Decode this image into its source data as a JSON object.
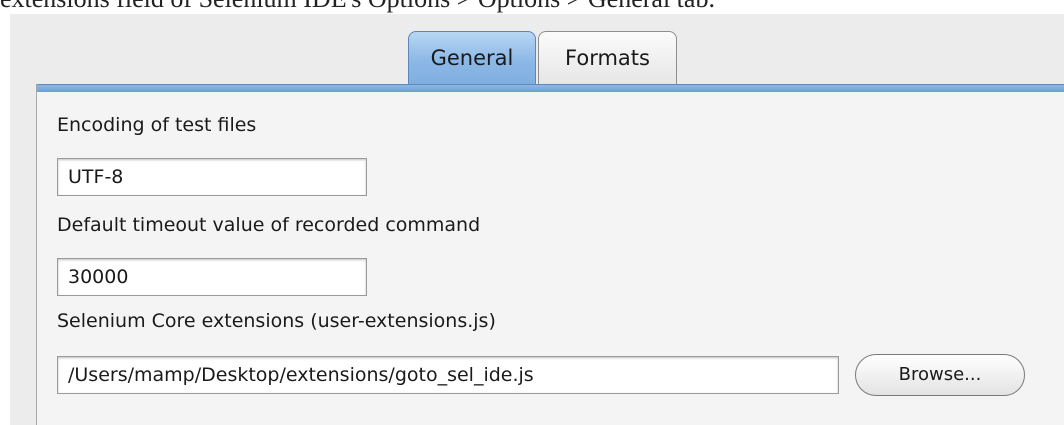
{
  "caption": "extensions field of Selenium IDE's Options > Options > General tab.",
  "tabs": [
    {
      "label": "General",
      "selected": true
    },
    {
      "label": "Formats",
      "selected": false
    }
  ],
  "general": {
    "encoding_label": "Encoding of test files",
    "encoding_value": "UTF-8",
    "timeout_label": "Default timeout value of recorded command",
    "timeout_value": "30000",
    "core_ext_label": "Selenium Core extensions (user-extensions.js)",
    "core_ext_value": "/Users/mamp/Desktop/extensions/goto_sel_ide.js",
    "browse_label": "Browse..."
  },
  "colors": {
    "selected_tab": "#8cb8e6",
    "panel_rule": "#7eaee0",
    "panel_bg": "#f4f4f4",
    "window_bg": "#ececec"
  }
}
